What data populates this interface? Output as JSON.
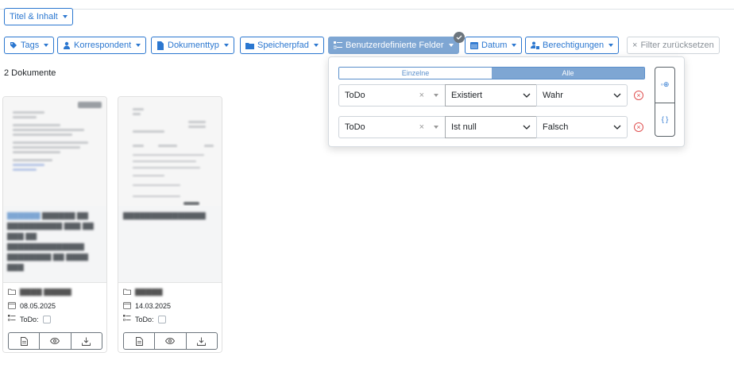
{
  "search": {
    "scope_label": "Titel & Inhalt"
  },
  "filters": {
    "tags": "Tags",
    "correspondent": "Korrespondent",
    "document_type": "Dokumenttyp",
    "storage_path": "Speicherpfad",
    "custom_fields": "Benutzerdefinierte Felder",
    "date": "Datum",
    "permissions": "Berechtigungen",
    "reset": "Filter zurücksetzen"
  },
  "result_count": "2 Dokumente",
  "custom_field_panel": {
    "mode_options": [
      "Einzelne",
      "Alle"
    ],
    "selected_mode": "Alle",
    "queries": [
      {
        "field": "ToDo",
        "operator": "Existiert",
        "value": "Wahr"
      },
      {
        "field": "ToDo",
        "operator": "Ist null",
        "value": "Falsch"
      }
    ]
  },
  "documents": [
    {
      "date": "08.05.2025",
      "custom_field_label": "ToDo:",
      "todo_checked": false
    },
    {
      "date": "14.03.2025",
      "custom_field_label": "ToDo:",
      "todo_checked": false
    }
  ],
  "colors": {
    "primary": "#2b77d0",
    "active_button": "#7ea6d3",
    "danger": "#e05252",
    "border": "#ced4da"
  }
}
